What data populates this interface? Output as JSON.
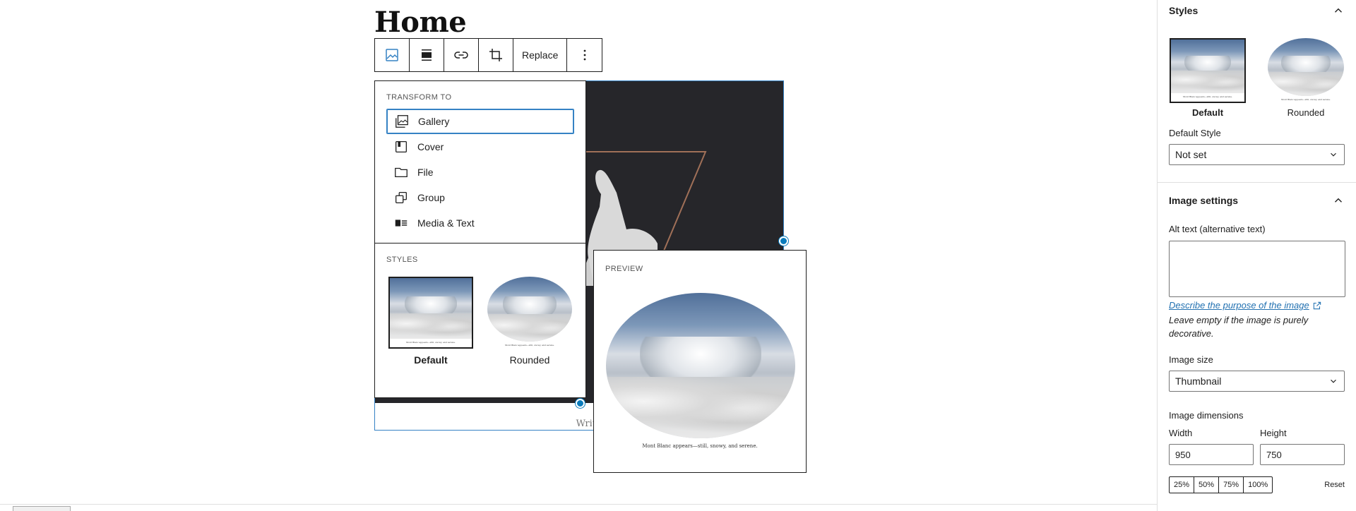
{
  "page": {
    "title": "Home"
  },
  "toolbar": {
    "replace_label": "Replace",
    "icons": [
      "image-icon",
      "align-icon",
      "link-icon",
      "crop-icon",
      "more-vertical-icon"
    ]
  },
  "transform_menu": {
    "heading": "Transform to",
    "items": [
      {
        "label": "Gallery",
        "icon": "gallery-icon"
      },
      {
        "label": "Cover",
        "icon": "cover-icon"
      },
      {
        "label": "File",
        "icon": "file-icon"
      },
      {
        "label": "Group",
        "icon": "group-icon"
      },
      {
        "label": "Media & Text",
        "icon": "media-text-icon"
      }
    ],
    "styles_heading": "Styles",
    "styles": [
      {
        "label": "Default",
        "selected": true
      },
      {
        "label": "Rounded",
        "selected": false
      }
    ]
  },
  "image_block": {
    "caption_placeholder": "Write captio"
  },
  "preview": {
    "heading": "Preview",
    "caption": "Mont Blanc appears—still, snowy, and serene."
  },
  "thumb_caption": "Mont Blanc appears—still, snowy, and serene.",
  "sidebar": {
    "styles_panel": {
      "title": "Styles",
      "styles": [
        {
          "label": "Default",
          "selected": true
        },
        {
          "label": "Rounded",
          "selected": false
        }
      ],
      "default_style_label": "Default Style",
      "default_style_value": "Not set"
    },
    "image_settings": {
      "title": "Image settings",
      "alt_label": "Alt text (alternative text)",
      "alt_value": "",
      "help_link": "Describe the purpose of the image",
      "help_text": "Leave empty if the image is purely decorative.",
      "size_label": "Image size",
      "size_value": "Thumbnail",
      "dimensions_label": "Image dimensions",
      "width_label": "Width",
      "width_value": "950",
      "height_label": "Height",
      "height_value": "750",
      "percent_options": [
        "25%",
        "50%",
        "75%",
        "100%"
      ],
      "reset_label": "Reset"
    }
  },
  "colors": {
    "accent": "#3582c4",
    "handle": "#0a7cbd",
    "link": "#2271b1",
    "image_bg": "#26262a"
  }
}
